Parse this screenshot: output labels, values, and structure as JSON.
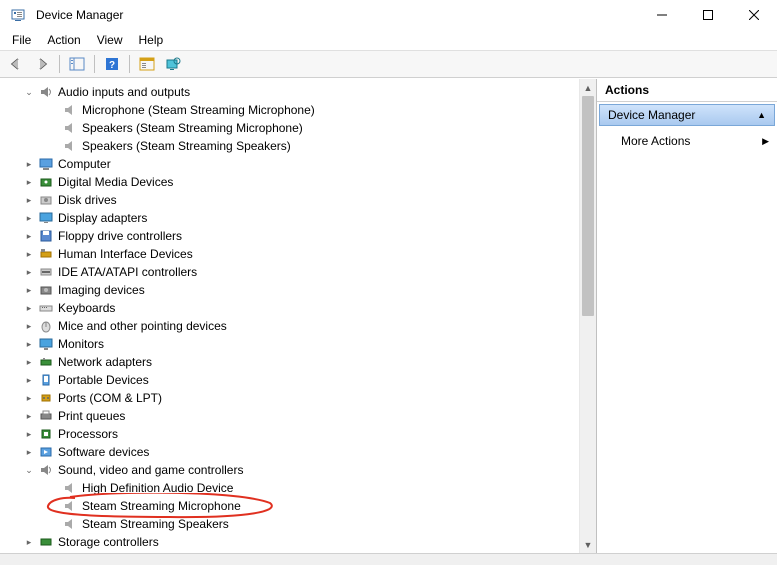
{
  "window": {
    "title": "Device Manager"
  },
  "menu": {
    "file": "File",
    "action": "Action",
    "view": "View",
    "help": "Help"
  },
  "actions": {
    "header": "Actions",
    "section": "Device Manager",
    "more": "More Actions"
  },
  "tree": {
    "audio_inputs": "Audio inputs and outputs",
    "microphone_ssm": "Microphone (Steam Streaming Microphone)",
    "speakers_ssm": "Speakers (Steam Streaming Microphone)",
    "speakers_sss": "Speakers (Steam Streaming Speakers)",
    "computer": "Computer",
    "digital_media": "Digital Media Devices",
    "disk_drives": "Disk drives",
    "display_adapters": "Display adapters",
    "floppy": "Floppy drive controllers",
    "hid": "Human Interface Devices",
    "ide": "IDE ATA/ATAPI controllers",
    "imaging": "Imaging devices",
    "keyboards": "Keyboards",
    "mice": "Mice and other pointing devices",
    "monitors": "Monitors",
    "network": "Network adapters",
    "portable": "Portable Devices",
    "ports": "Ports (COM & LPT)",
    "print_queues": "Print queues",
    "processors": "Processors",
    "software_devices": "Software devices",
    "sound_video": "Sound, video and game controllers",
    "hd_audio": "High Definition Audio Device",
    "steam_mic": "Steam Streaming Microphone",
    "steam_spk": "Steam Streaming Speakers",
    "storage": "Storage controllers"
  }
}
